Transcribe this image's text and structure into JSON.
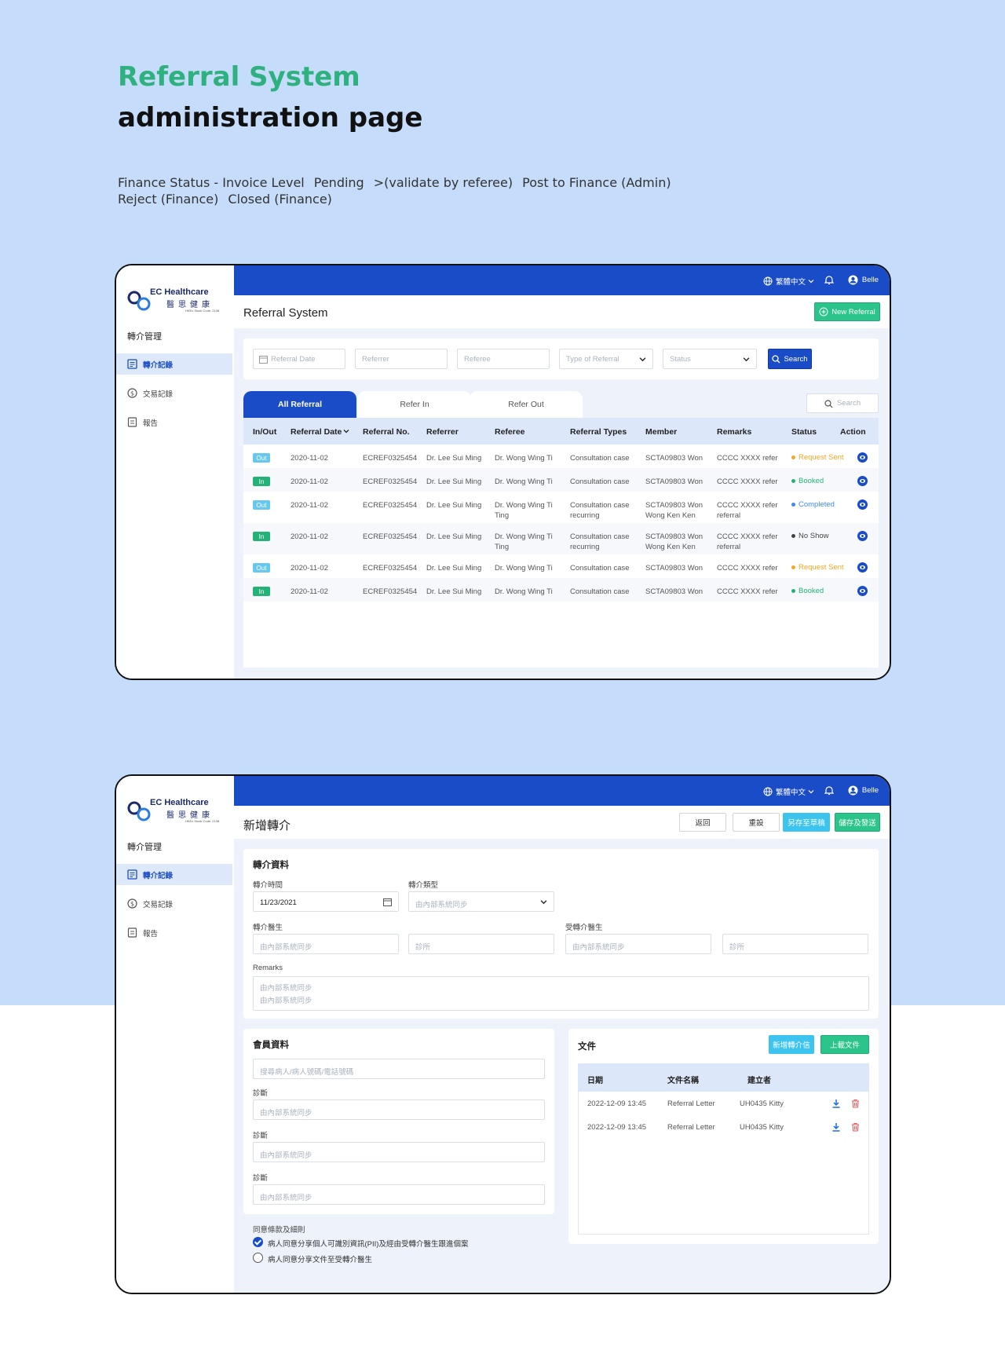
{
  "hero": {
    "title": "Referral System",
    "subtitle": "administration page"
  },
  "finance_status": [
    "Finance Status - Invoice Level",
    "Pending",
    ">(validate by referee)",
    "Post to Finance (Admin)",
    "Reject (Finance)",
    "Closed (Finance)"
  ],
  "colors": {
    "primary": "#1a4cc8",
    "green": "#2bc48a",
    "cyan": "#3cc4ee",
    "background": "#c5dcfa",
    "request_sent": "#f5a623",
    "booked": "#25b278",
    "completed": "#3c8cf0",
    "no_show": "#444444"
  },
  "app": {
    "logo_en": "EC Healthcare",
    "logo_zh": "醫思健康",
    "logo_code": "HKEx Stock Code: 2138",
    "sidebar_section": "轉介管理",
    "sidebar_items": [
      "轉介記錄",
      "交易記錄",
      "報告"
    ],
    "lang": "繁體中文",
    "user": "Belle"
  },
  "screen1": {
    "page_title": "Referral System",
    "new_referral": "New Referral",
    "filters": {
      "referral_date": "Referral Date",
      "referrer": "Referrer",
      "referee": "Referee",
      "type_of_referral": "Type of Referral",
      "status": "Status",
      "search_button": "Search"
    },
    "tabs": [
      "All Referral",
      "Refer In",
      "Refer Out"
    ],
    "table_search": "Search",
    "columns": [
      "In/Out",
      "Referral Date",
      "Referral No.",
      "Referrer",
      "Referee",
      "Referral Types",
      "Member",
      "Remarks",
      "Status",
      "Action"
    ],
    "rows": [
      {
        "dir": "Out",
        "date": "2020-11-02",
        "no": "ECREF0325454",
        "referrer": "Dr. Lee Sui Ming",
        "referee": "Dr. Wong Wing Ti",
        "referee2": "",
        "type": "Consultation case",
        "type2": "",
        "member": "SCTA09803 Won",
        "member2": "",
        "remarks": "CCCC XXXX refer",
        "remarks2": "",
        "status": "Request Sent",
        "status_color": "#f5a623"
      },
      {
        "dir": "In",
        "date": "2020-11-02",
        "no": "ECREF0325454",
        "referrer": "Dr. Lee Sui Ming",
        "referee": "Dr. Wong Wing Ti",
        "referee2": "",
        "type": "Consultation case",
        "type2": "",
        "member": "SCTA09803 Won",
        "member2": "",
        "remarks": "CCCC XXXX refer",
        "remarks2": "",
        "status": "Booked",
        "status_color": "#25b278"
      },
      {
        "dir": "Out",
        "date": "2020-11-02",
        "no": "ECREF0325454",
        "referrer": "Dr. Lee Sui Ming",
        "referee": "Dr. Wong Wing Ti",
        "referee2": "Ting",
        "type": "Consultation case",
        "type2": "recurring",
        "member": "SCTA09803 Won",
        "member2": "Wong Ken Ken",
        "remarks": "CCCC XXXX refer",
        "remarks2": "referral",
        "status": "Completed",
        "status_color": "#3c8cf0"
      },
      {
        "dir": "In",
        "date": "2020-11-02",
        "no": "ECREF0325454",
        "referrer": "Dr. Lee Sui Ming",
        "referee": "Dr. Wong Wing Ti",
        "referee2": "Ting",
        "type": "Consultation case",
        "type2": "recurring",
        "member": "SCTA09803 Won",
        "member2": "Wong Ken Ken",
        "remarks": "CCCC XXXX refer",
        "remarks2": "referral",
        "status": "No Show",
        "status_color": "#444444"
      },
      {
        "dir": "Out",
        "date": "2020-11-02",
        "no": "ECREF0325454",
        "referrer": "Dr. Lee Sui Ming",
        "referee": "Dr. Wong Wing Ti",
        "referee2": "",
        "type": "Consultation case",
        "type2": "",
        "member": "SCTA09803 Won",
        "member2": "",
        "remarks": "CCCC XXXX refer",
        "remarks2": "",
        "status": "Request Sent",
        "status_color": "#f5a623"
      },
      {
        "dir": "In",
        "date": "2020-11-02",
        "no": "ECREF0325454",
        "referrer": "Dr. Lee Sui Ming",
        "referee": "Dr. Wong Wing Ti",
        "referee2": "",
        "type": "Consultation case",
        "type2": "",
        "member": "SCTA09803 Won",
        "member2": "",
        "remarks": "CCCC XXXX refer",
        "remarks2": "",
        "status": "Booked",
        "status_color": "#25b278"
      }
    ]
  },
  "screen2": {
    "page_title": "新增轉介",
    "buttons": {
      "back": "返回",
      "reset": "重設",
      "save_draft": "另存至草稿",
      "save_send": "儲存及發送"
    },
    "referral_info": {
      "title": "轉介資料",
      "time_label": "轉介時間",
      "time_value": "11/23/2021",
      "type_label": "轉介類型",
      "type_placeholder": "由內部系統同步",
      "referrer_label": "轉介醫生",
      "referrer_placeholder": "由內部系統同步",
      "clinic_placeholder": "診所",
      "referee_label": "受轉介醫生",
      "referee_placeholder": "由內部系統同步",
      "clinic2_placeholder": "診所",
      "remarks_label": "Remarks",
      "remarks_line1": "由內部系統同步",
      "remarks_line2": "由內部系統同步"
    },
    "member_info": {
      "title": "會員資料",
      "search_placeholder": "搜尋病人/病人號碼/電話號碼",
      "diag_label": "診斷",
      "diag_placeholder": "由內部系統同步"
    },
    "terms": {
      "title": "同意條款及細則",
      "option1": "病人同意分享個人可識別資訊(PII)及經由受轉介醫生跟進個案",
      "option2": "病人同意分享文件至受轉介醫生"
    },
    "documents": {
      "title": "文件",
      "new_letter": "新增轉介信",
      "upload": "上載文件",
      "columns": [
        "日期",
        "文件名稱",
        "建立者"
      ],
      "rows": [
        {
          "date": "2022-12-09 13:45",
          "name": "Referral Letter",
          "creator": "UH0435 Kitty"
        },
        {
          "date": "2022-12-09 13:45",
          "name": "Referral Letter",
          "creator": "UH0435 Kitty"
        }
      ]
    }
  }
}
